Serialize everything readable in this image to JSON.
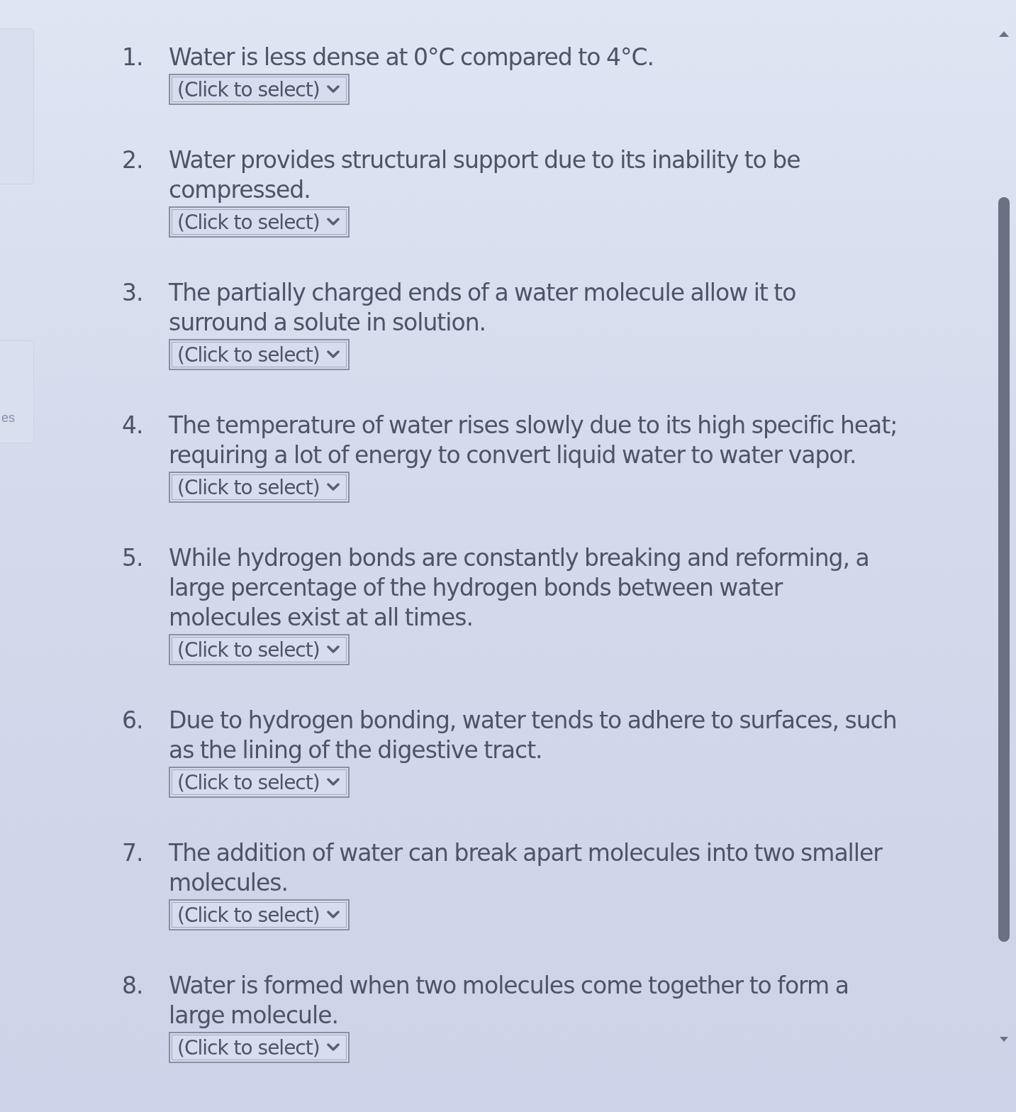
{
  "sidebar": {
    "label": "es"
  },
  "questions": [
    {
      "number": "1.",
      "text": "Water is less dense at 0°C compared to 4°C.",
      "answer": {
        "value": "(Click to select)"
      }
    },
    {
      "number": "2.",
      "text": "Water provides structural support due to its inability to be compressed.",
      "answer": {
        "value": "(Click to select)"
      }
    },
    {
      "number": "3.",
      "text": "The partially charged ends of a water molecule allow it to surround a solute in solution.",
      "answer": {
        "value": "(Click to select)"
      }
    },
    {
      "number": "4.",
      "text": "The temperature of water rises slowly due to its high specific heat; requiring a lot of energy to convert liquid water to water vapor.",
      "answer": {
        "value": "(Click to select)"
      }
    },
    {
      "number": "5.",
      "text": "While hydrogen bonds are constantly breaking and reforming, a large percentage of the hydrogen bonds between water molecules exist at all times.",
      "answer": {
        "value": "(Click to select)"
      }
    },
    {
      "number": "6.",
      "text": "Due to hydrogen bonding, water tends to adhere to surfaces, such as the lining of the digestive tract.",
      "answer": {
        "value": "(Click to select)"
      }
    },
    {
      "number": "7.",
      "text": "The addition of water can break apart molecules into two smaller molecules.",
      "answer": {
        "value": "(Click to select)"
      }
    },
    {
      "number": "8.",
      "text": "Water is formed when two molecules come together to form a large molecule.",
      "answer": {
        "value": "(Click to select)"
      }
    }
  ]
}
